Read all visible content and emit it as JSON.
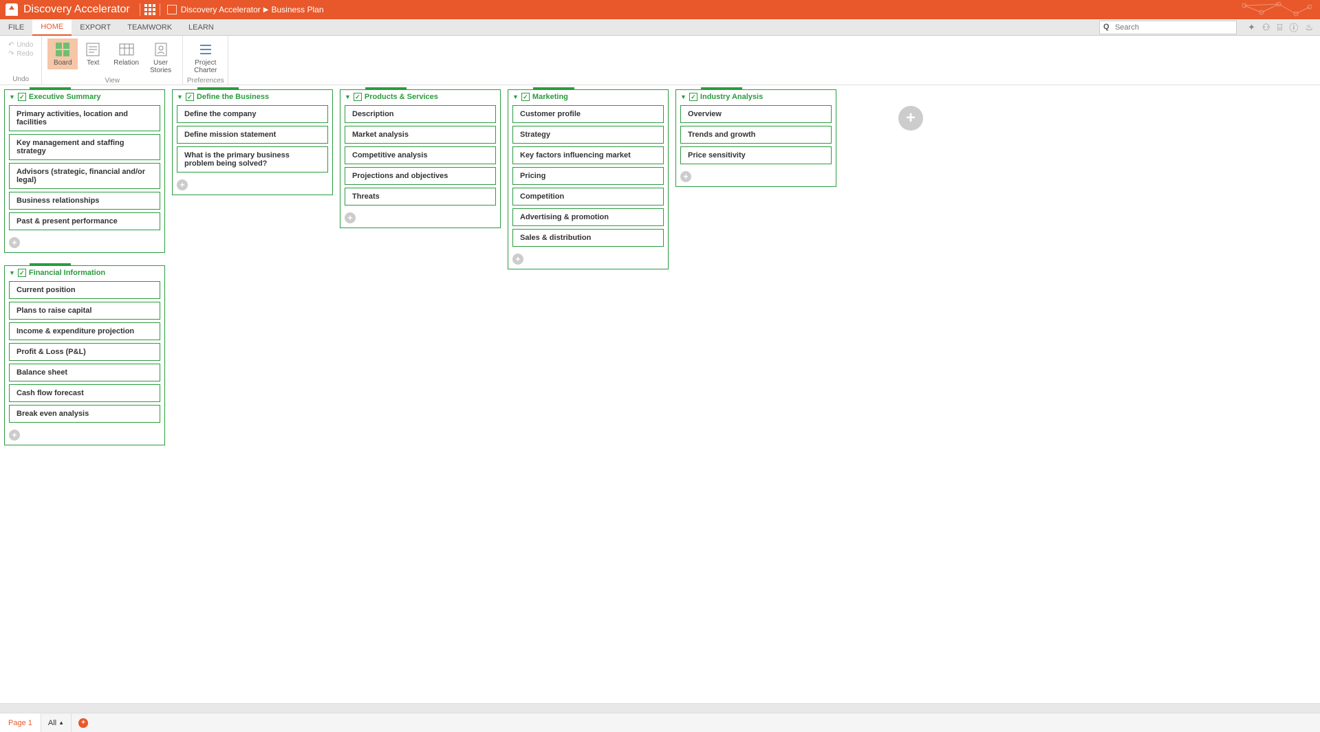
{
  "header": {
    "app_title": "Discovery Accelerator",
    "breadcrumb_root": "Discovery Accelerator",
    "breadcrumb_current": "Business Plan"
  },
  "menu": {
    "items": [
      "FILE",
      "HOME",
      "EXPORT",
      "TEAMWORK",
      "LEARN"
    ],
    "active_index": 1,
    "search_placeholder": "Search"
  },
  "ribbon": {
    "undo_label": "Undo",
    "redo_label": "Redo",
    "undo_group": "Undo",
    "view_group": "View",
    "pref_group": "Preferences",
    "buttons": {
      "board": "Board",
      "text": "Text",
      "relation": "Relation",
      "user_stories": "User\nStories",
      "project_charter": "Project\nCharter"
    }
  },
  "board": {
    "columns": [
      {
        "title": "Executive Summary",
        "cards": [
          "Primary activities, location and facilities",
          "Key management and staffing strategy",
          "Advisors (strategic, financial and/or legal)",
          "Business relationships",
          "Past & present performance"
        ]
      },
      {
        "title": "Define the Business",
        "cards": [
          "Define the company",
          "Define mission statement",
          "What is the primary business problem being solved?"
        ]
      },
      {
        "title": "Products & Services",
        "cards": [
          "Description",
          "Market analysis",
          "Competitive analysis",
          "Projections and objectives",
          "Threats"
        ]
      },
      {
        "title": "Marketing",
        "cards": [
          "Customer profile",
          "Strategy",
          "Key factors influencing market",
          "Pricing",
          "Competition",
          "Advertising & promotion",
          "Sales & distribution"
        ]
      },
      {
        "title": "Industry Analysis",
        "cards": [
          "Overview",
          "Trends and growth",
          "Price sensitivity"
        ]
      },
      {
        "title": "Financial Information",
        "cards": [
          "Current position",
          "Plans to raise capital",
          "Income & expenditure projection",
          "Profit & Loss (P&L)",
          "Balance sheet",
          "Cash flow forecast",
          "Break even analysis"
        ]
      }
    ]
  },
  "status": {
    "page_label": "Page 1",
    "all_label": "All"
  }
}
